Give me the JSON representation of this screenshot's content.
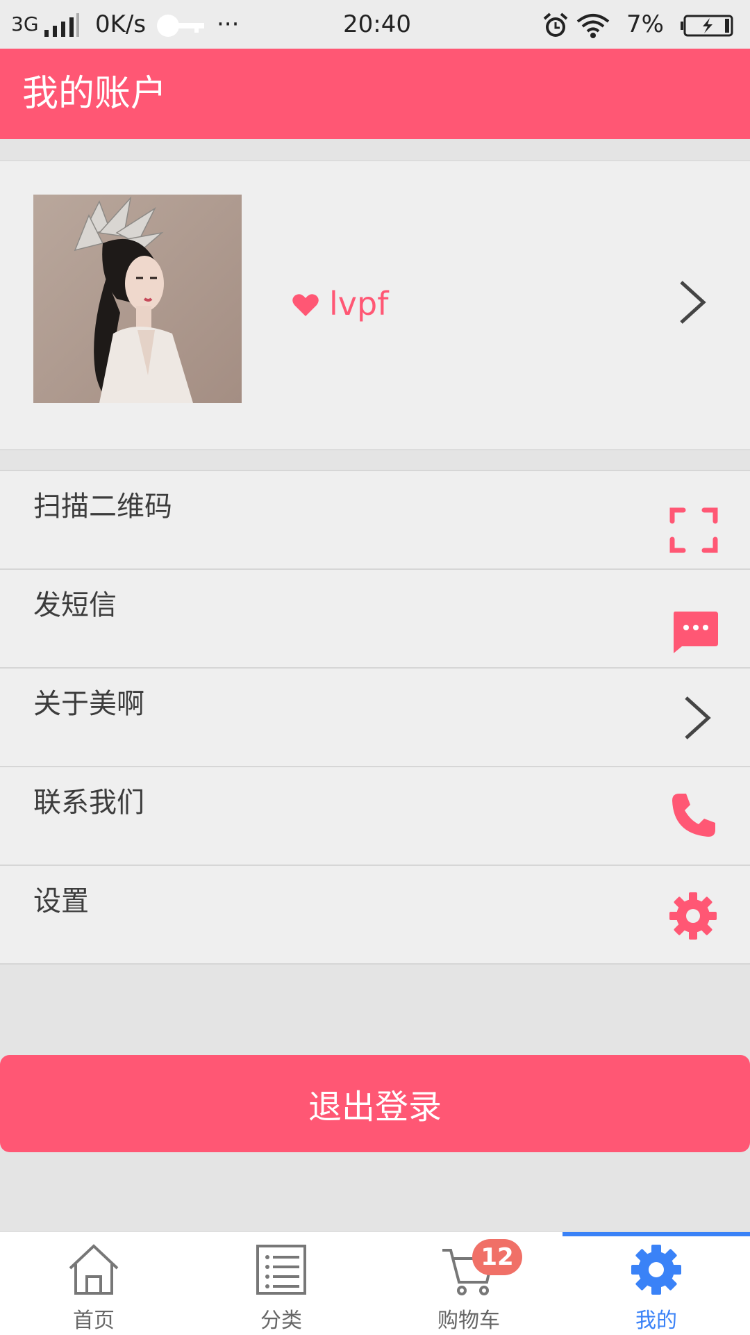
{
  "status_bar": {
    "network": "3G",
    "speed": "0K/s",
    "more": "···",
    "time": "20:40",
    "battery": "7%"
  },
  "header": {
    "title": "我的账户"
  },
  "profile": {
    "username": "lvpf"
  },
  "menu": {
    "items": [
      {
        "label": "扫描二维码",
        "icon": "scan-qr-icon"
      },
      {
        "label": "发短信",
        "icon": "message-icon"
      },
      {
        "label": "关于美啊",
        "icon": "chevron-right-icon"
      },
      {
        "label": "联系我们",
        "icon": "phone-icon"
      },
      {
        "label": "设置",
        "icon": "gear-icon"
      }
    ]
  },
  "logout": {
    "label": "退出登录"
  },
  "bottom_nav": {
    "tabs": [
      {
        "label": "首页",
        "icon": "home-icon"
      },
      {
        "label": "分类",
        "icon": "list-icon"
      },
      {
        "label": "购物车",
        "icon": "cart-icon",
        "badge": "12"
      },
      {
        "label": "我的",
        "icon": "gear-icon",
        "active": true
      }
    ]
  },
  "colors": {
    "accent": "#ff5774",
    "active_tab": "#3a82f7",
    "badge": "#f07067"
  }
}
